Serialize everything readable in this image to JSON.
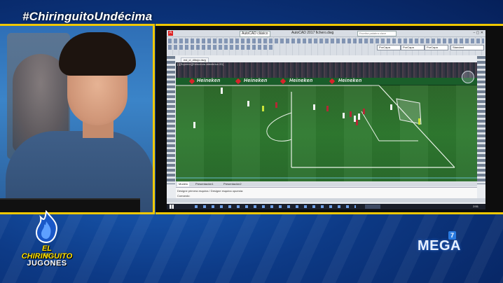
{
  "broadcast": {
    "hashtag": "#ChiringuitoUndécima",
    "show_logo_line1": "EL CHIRINGUITO",
    "show_logo_small": "DE",
    "show_logo_line2": "JUGONES",
    "channel": "MEGA",
    "channel_badge": "7"
  },
  "autocad": {
    "workspace": "AutoCAD clásico",
    "title": "AutoCAD 2017  fichero.dwg",
    "help_placeholder": "Escriba palabra clave",
    "window_controls": "– ▢ ✕",
    "ribbon_selects": [
      "PorCapa",
      "PorCapa",
      "PorCapa",
      "Standard"
    ],
    "doc_tab": "est_cl_dibujo.dwg",
    "viewport_label": "[-][Superior][Estructura alámbrica 2D]",
    "layout_tabs": [
      "Modelo",
      "Presentación1",
      "Presentación2"
    ],
    "command_history": "Designe primera esquina / Designe esquina opuesta:",
    "command_prompt": "Comando:",
    "clock": "2:51",
    "ad_text": "Heineken"
  },
  "colors": {
    "accent_border": "#f0c800",
    "grass": "#2f7a30",
    "ad_star": "#d8232a"
  }
}
